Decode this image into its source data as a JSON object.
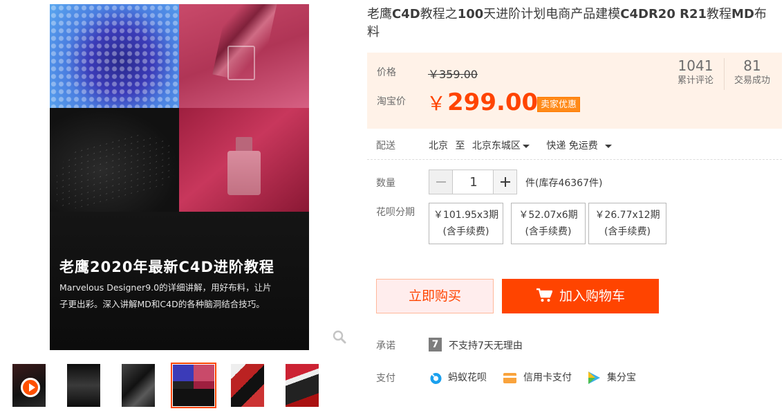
{
  "product": {
    "title_parts": [
      {
        "text": "老鹰",
        "bold": false
      },
      {
        "text": "C4D",
        "bold": true
      },
      {
        "text": "教程之",
        "bold": false
      },
      {
        "text": "100",
        "bold": true
      },
      {
        "text": "天进阶计划电商产品建模",
        "bold": false
      },
      {
        "text": "C4DR20 R21",
        "bold": true
      },
      {
        "text": "教程",
        "bold": false
      },
      {
        "text": "MD",
        "bold": true
      },
      {
        "text": "布料",
        "bold": false
      }
    ]
  },
  "gallery": {
    "banner_title": "老鹰2020年最新C4D进阶教程",
    "banner_desc_line1": "Marvelous Designer9.0的详细讲解，用好布料，让片",
    "banner_desc_line2": "子更出彩。深入讲解MD和C4D的各种脑洞结合技巧。",
    "zoom_icon": "search-icon",
    "thumbnails": [
      {
        "label": "video-thumbnail",
        "has_play": true,
        "active": false,
        "tone": "#2a1e1e"
      },
      {
        "label": "thumbnail-2",
        "has_play": false,
        "active": false,
        "tone": "#1c1c1c"
      },
      {
        "label": "thumbnail-3",
        "has_play": false,
        "active": false,
        "tone": "#2d2d2d"
      },
      {
        "label": "thumbnail-4",
        "has_play": false,
        "active": true,
        "tone": "#1b1b3a"
      },
      {
        "label": "thumbnail-5",
        "has_play": false,
        "active": false,
        "tone": "#7a1a2a"
      },
      {
        "label": "thumbnail-6",
        "has_play": false,
        "active": false,
        "tone": "#5a1020"
      }
    ]
  },
  "price": {
    "original_label": "价格",
    "original_value": "￥359.00",
    "taobao_label": "淘宝价",
    "currency": "￥",
    "current_value": "299.00",
    "promo_tag": "卖家优惠",
    "accent_color": "#ff4400",
    "reviews_count": "1041",
    "reviews_label": "累计评论",
    "sold_count": "81",
    "sold_label": "交易成功"
  },
  "delivery": {
    "label": "配送",
    "from": "北京",
    "to_word": "至",
    "destination": "北京东城区",
    "method": "快递 免运费"
  },
  "quantity": {
    "label": "数量",
    "value": "1",
    "stock": "件(库存46367件)"
  },
  "installments": {
    "label": "花呗分期",
    "options": [
      {
        "amount": "￥101.95x3期",
        "fee": "(含手续费)"
      },
      {
        "amount": "￥52.07x6期",
        "fee": "(含手续费)"
      },
      {
        "amount": "￥26.77x12期",
        "fee": "(含手续费)"
      }
    ]
  },
  "actions": {
    "buy_now": "立即购买",
    "add_to_cart": "加入购物车"
  },
  "promise": {
    "label": "承诺",
    "icon_text": "7",
    "text": "不支持7天无理由"
  },
  "payment": {
    "label": "支付",
    "methods": [
      {
        "name": "蚂蚁花呗",
        "icon": "huabei-icon",
        "color": "#1aa0ee"
      },
      {
        "name": "信用卡支付",
        "icon": "credit-card-icon",
        "color": "#f9a33c"
      },
      {
        "name": "集分宝",
        "icon": "jifenbao-icon",
        "color": "#3cb0e8"
      }
    ]
  }
}
